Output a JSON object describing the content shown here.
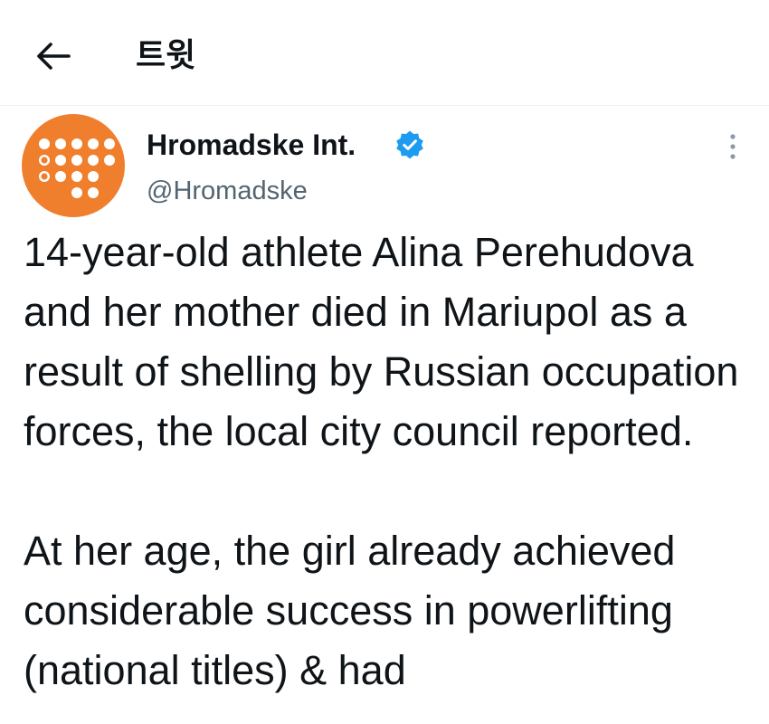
{
  "header": {
    "title": "트윗",
    "back_icon": "arrow-left-icon"
  },
  "author": {
    "display_name": "Hromadske Int.",
    "handle": "@Hromadske",
    "verified": true,
    "verified_icon": "verified-badge-icon",
    "avatar_color": "#f07f2d"
  },
  "tweet": {
    "text": "14-year-old athlete Alina Perehudova and her mother died in Mariupol as a result of shelling by Russian occupation forces, the local city council reported.\n\nAt her age, the girl already achieved considerable success in powerlifting (national titles) & had"
  },
  "colors": {
    "verified_blue": "#1d9bf0",
    "text_primary": "#0f1419",
    "text_secondary": "#536471"
  }
}
